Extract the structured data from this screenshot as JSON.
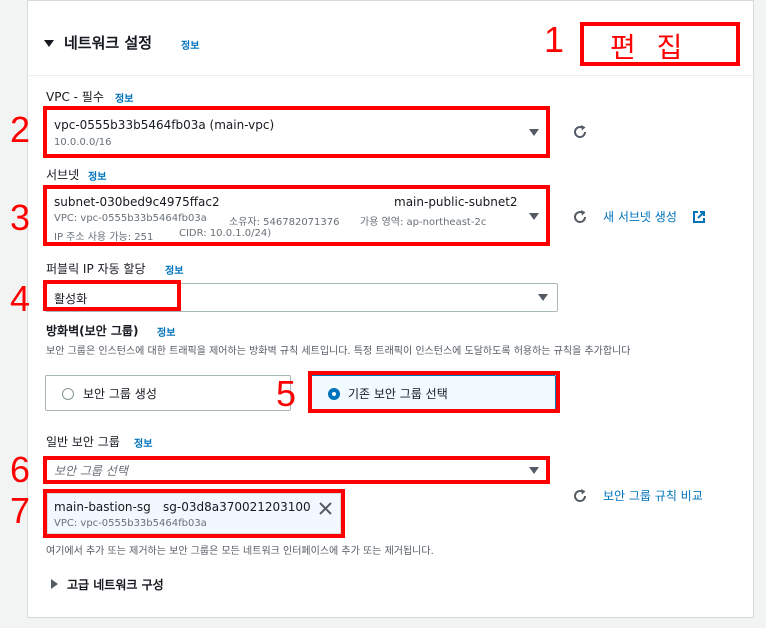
{
  "section": {
    "title": "네트워크 설정",
    "info": "정보",
    "edit_label": "편 집"
  },
  "vpc": {
    "label": "VPC - 필수",
    "info": "정보",
    "selected_name": "vpc-0555b33b5464fb03a (main-vpc)",
    "selected_cidr": "10.0.0.0/16"
  },
  "subnet": {
    "label": "서브넷",
    "info": "정보",
    "id": "subnet-030bed9c4975ffac2",
    "name": "main-public-subnet2",
    "vpc_line": "VPC: vpc-0555b33b5464fb03a",
    "owner_line": "소유자: 546782071376",
    "az_line": "가용 영역: ap-northeast-2c",
    "ip_line": "IP 주소 사용 가능: 251",
    "cidr_line": "CIDR: 10.0.1.0/24)",
    "create_link": "새 서브넷 생성"
  },
  "public_ip": {
    "label": "퍼블릭 IP 자동 할당",
    "info": "정보",
    "value": "활성화"
  },
  "firewall": {
    "label": "방화벽(보안 그룹)",
    "info": "정보",
    "description": "보안 그룹은 인스턴스에 대한 트래픽을 제어하는 방화벽 규칙 세트입니다. 특정 트래픽이 인스턴스에 도달하도록 허용하는 규칙을 추가합니다",
    "option_create": "보안 그룹 생성",
    "option_existing": "기존 보안 그룹 선택"
  },
  "security_groups": {
    "label": "일반 보안 그룹",
    "info": "정보",
    "placeholder": "보안 그룹 선택",
    "compare_link": "보안 그룹 규칙 비교",
    "token_name": "main-bastion-sg",
    "token_id": "sg-03d8a370021203100",
    "token_vpc": "VPC: vpc-0555b33b5464fb03a",
    "footer_note": "여기에서 추가 또는 제거하는 보안 그룹은 모든 네트워크 인터페이스에 추가 또는 제거됩니다."
  },
  "advanced": {
    "label": "고급 네트워크 구성"
  },
  "annotations": [
    "1",
    "2",
    "3",
    "4",
    "5",
    "6",
    "7"
  ],
  "icons": {
    "refresh": "refresh-icon",
    "external": "external-link-icon",
    "close": "close-icon"
  },
  "colors": {
    "link": "#0073bb",
    "annotation_red": "#ff0000",
    "selected_card_bg": "#f1faff"
  }
}
